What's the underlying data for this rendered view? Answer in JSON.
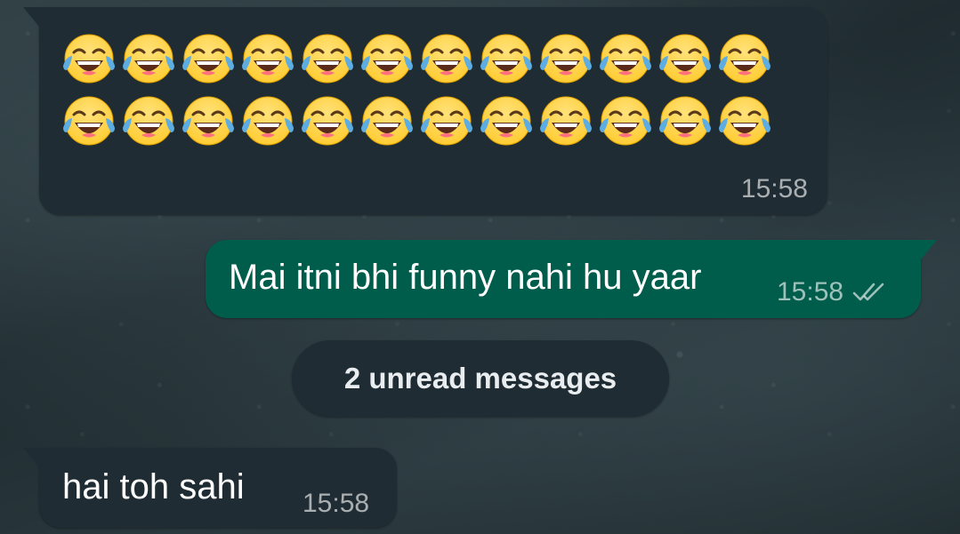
{
  "chat": {
    "messages": [
      {
        "direction": "incoming",
        "emoji": "face-with-tears-of-joy",
        "emoji_rows": [
          12,
          12
        ],
        "time": "15:58"
      },
      {
        "direction": "outgoing",
        "text": "Mai itni bhi funny nahi hu yaar",
        "time": "15:58",
        "status": "read-double-tick"
      },
      {
        "direction": "incoming",
        "text": "hai toh sahi",
        "time": "15:58"
      }
    ],
    "unread_divider": "2 unread messages"
  },
  "colors": {
    "incoming_bubble": "#1f2c33",
    "outgoing_bubble": "#005c4b",
    "timestamp": "#a6adb0",
    "emoji_face": "#ffcc33",
    "emoji_tear": "#5dade2"
  }
}
